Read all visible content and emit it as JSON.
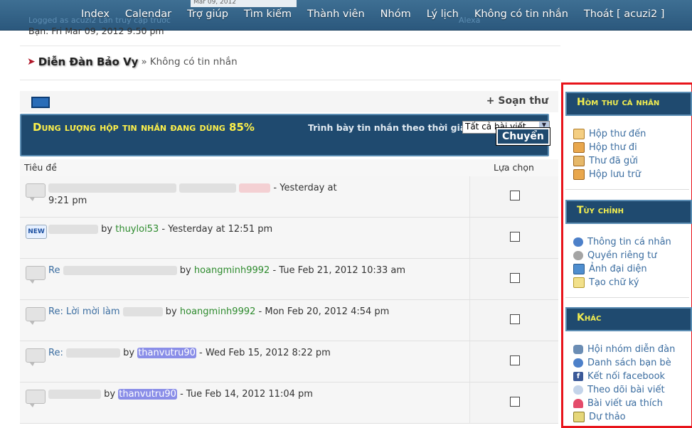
{
  "nav": {
    "items": [
      "Index",
      "Calendar",
      "Trợ giúp",
      "Tìm kiếm",
      "Thành viên",
      "Nhóm",
      "Lý lịch",
      "Không có tin nhắn",
      "Thoát [ acuzi2 ]"
    ],
    "ghost_left": "Logged as acuzi2  Lần truy cập trước",
    "ghost_date": "Mar 09, 2012",
    "ghost_right": "Alexa"
  },
  "last_visit": "Bạn: Fri Mar 09, 2012 9:50 pm",
  "breadcrumb": {
    "forum": "Diễn Đàn Bảo Vy",
    "separator": "»",
    "current": "Không có tin nhắn"
  },
  "toolbar": {
    "compose": "+ Soạn thư"
  },
  "quota": {
    "text": "Dung lượng hộp tin nhắn đang dùng 85%",
    "sort_label": "Trình bày tin nhắn theo thời gian:",
    "sort_value": "Tất cả bài viết",
    "go_button": "Chuyển"
  },
  "table": {
    "col_title": "Tiêu đề",
    "col_select": "Lựa chọn",
    "rows": [
      {
        "prefix": "",
        "by": "",
        "user": "",
        "date": "- Yesterday at",
        "date2": "9:21 pm",
        "style": "plain",
        "icon": "bubble"
      },
      {
        "prefix": "",
        "by": "by",
        "user": "thuyloi53",
        "date": "- Yesterday at 12:51 pm",
        "date2": "",
        "style": "green",
        "icon": "new"
      },
      {
        "prefix": "Re",
        "by": "by",
        "user": "hoangminh9992",
        "date": "- Tue Feb 21, 2012 10:33 am",
        "date2": "",
        "style": "green",
        "icon": "bubble"
      },
      {
        "prefix": "Re: Lời mời làm",
        "by": "by",
        "user": "hoangminh9992",
        "date": "- Mon Feb 20, 2012 4:54 pm",
        "date2": "",
        "style": "green",
        "icon": "bubble"
      },
      {
        "prefix": "Re:",
        "by": "by",
        "user": "thanvutru90",
        "date": "- Wed Feb 15, 2012 8:22 pm",
        "date2": "",
        "style": "hl",
        "icon": "bubble"
      },
      {
        "prefix": "",
        "by": "by",
        "user": "thanvutru90",
        "date": "- Tue Feb 14, 2012 11:04 pm",
        "date2": "",
        "style": "hl",
        "icon": "bubble"
      }
    ],
    "new_badge": "NEW"
  },
  "sidebar": {
    "sections": [
      {
        "title": "Hòm thư cá nhân",
        "items": [
          {
            "label": "Hộp thư đến",
            "icon": "inbox-icon"
          },
          {
            "label": "Hộp thư đi",
            "icon": "outbox-icon"
          },
          {
            "label": "Thư đã gửi",
            "icon": "sent-icon"
          },
          {
            "label": "Hộp lưu trữ",
            "icon": "archive-icon"
          }
        ]
      },
      {
        "title": "Tùy chỉnh",
        "items": [
          {
            "label": "Thông tin cá nhân",
            "icon": "user-icon"
          },
          {
            "label": "Quyền riêng tư",
            "icon": "gear-icon"
          },
          {
            "label": "Ảnh đại diện",
            "icon": "avatar-icon"
          },
          {
            "label": "Tạo chữ ký",
            "icon": "signature-icon"
          }
        ]
      },
      {
        "title": "Khác",
        "items": [
          {
            "label": "Hội nhóm diễn đàn",
            "icon": "group-icon"
          },
          {
            "label": "Danh sách bạn bè",
            "icon": "friends-icon"
          },
          {
            "label": "Kết nối facebook",
            "icon": "facebook-icon"
          },
          {
            "label": "Theo dõi bài viết",
            "icon": "watch-icon"
          },
          {
            "label": "Bài viết ưa thích",
            "icon": "heart-icon"
          },
          {
            "label": "Dự thảo",
            "icon": "draft-icon"
          }
        ]
      }
    ]
  },
  "colors": {
    "nav_bg": "#2f5f86",
    "panel_bg": "#1f4a6f",
    "highlight_text": "#fdf04a",
    "sidebar_border": "#e8141b"
  }
}
